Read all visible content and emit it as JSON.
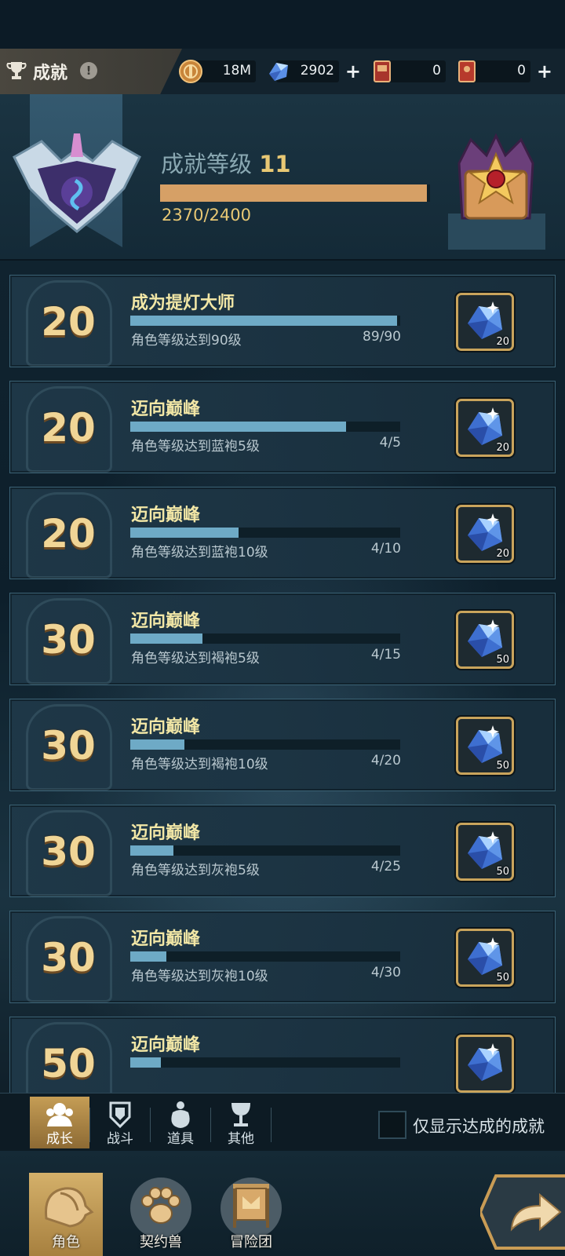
{
  "header": {
    "title": "成就",
    "info": "!",
    "resources": [
      {
        "icon": "gold-coin-icon",
        "value": "18M",
        "has_plus": false
      },
      {
        "icon": "blue-crystal-icon",
        "value": "2902",
        "has_plus": true
      },
      {
        "icon": "red-ticket-icon",
        "value": "0",
        "has_plus": false
      },
      {
        "icon": "red-card-icon",
        "value": "0",
        "has_plus": true
      }
    ]
  },
  "level": {
    "label": "成就等级",
    "number": "11",
    "progress_text": "2370/2400",
    "progress_fraction": 0.9875
  },
  "achievements": [
    {
      "points": "20",
      "title": "成为提灯大师",
      "desc": "角色等级达到90级",
      "count": "89/90",
      "fraction": 0.989,
      "reward_qty": "20"
    },
    {
      "points": "20",
      "title": "迈向巅峰",
      "desc": "角色等级达到蓝袍5级",
      "count": "4/5",
      "fraction": 0.8,
      "reward_qty": "20"
    },
    {
      "points": "20",
      "title": "迈向巅峰",
      "desc": "角色等级达到蓝袍10级",
      "count": "4/10",
      "fraction": 0.4,
      "reward_qty": "20"
    },
    {
      "points": "30",
      "title": "迈向巅峰",
      "desc": "角色等级达到褐袍5级",
      "count": "4/15",
      "fraction": 0.267,
      "reward_qty": "50"
    },
    {
      "points": "30",
      "title": "迈向巅峰",
      "desc": "角色等级达到褐袍10级",
      "count": "4/20",
      "fraction": 0.2,
      "reward_qty": "50"
    },
    {
      "points": "30",
      "title": "迈向巅峰",
      "desc": "角色等级达到灰袍5级",
      "count": "4/25",
      "fraction": 0.16,
      "reward_qty": "50"
    },
    {
      "points": "30",
      "title": "迈向巅峰",
      "desc": "角色等级达到灰袍10级",
      "count": "4/30",
      "fraction": 0.133,
      "reward_qty": "50"
    },
    {
      "points": "50",
      "title": "迈向巅峰",
      "desc": "",
      "count": "",
      "fraction": 0.114,
      "reward_qty": ""
    }
  ],
  "tabs": [
    {
      "label": "成长",
      "icon": "growth-icon",
      "active": true
    },
    {
      "label": "战斗",
      "icon": "battle-icon",
      "active": false
    },
    {
      "label": "道具",
      "icon": "item-bag-icon",
      "active": false
    },
    {
      "label": "其他",
      "icon": "goblet-icon",
      "active": false
    }
  ],
  "filter": {
    "label": "仅显示达成的成就",
    "checked": false
  },
  "bottom_nav": [
    {
      "label": "角色",
      "icon": "character-helmet-icon",
      "active": true
    },
    {
      "label": "契约兽",
      "icon": "paw-icon",
      "active": false
    },
    {
      "label": "冒险团",
      "icon": "guild-banner-icon",
      "active": false
    }
  ],
  "colors": {
    "accent_gold": "#e8c874",
    "progress_blue": "#6eaac6",
    "level_bar": "#d6a066"
  }
}
